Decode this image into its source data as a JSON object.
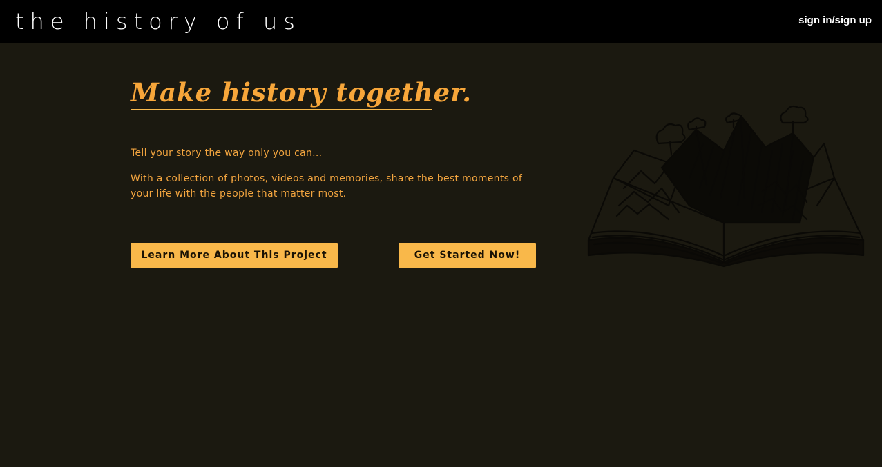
{
  "header": {
    "brand": "the history of us",
    "auth_link": "sign in/sign up"
  },
  "hero": {
    "title": "Make history together.",
    "tagline": "Tell your story the way only you can...",
    "description": "With a collection of photos, videos and memories, share the best moments of your life with the people that matter most.",
    "learn_more_label": "Learn More About This Project",
    "get_started_label": "Get Started Now!"
  },
  "illustration": {
    "icon": "pop-up-book-icon"
  },
  "colors": {
    "background": "#1b1910",
    "topbar": "#000000",
    "accent": "#f7a63a",
    "button": "#f9b84a"
  }
}
